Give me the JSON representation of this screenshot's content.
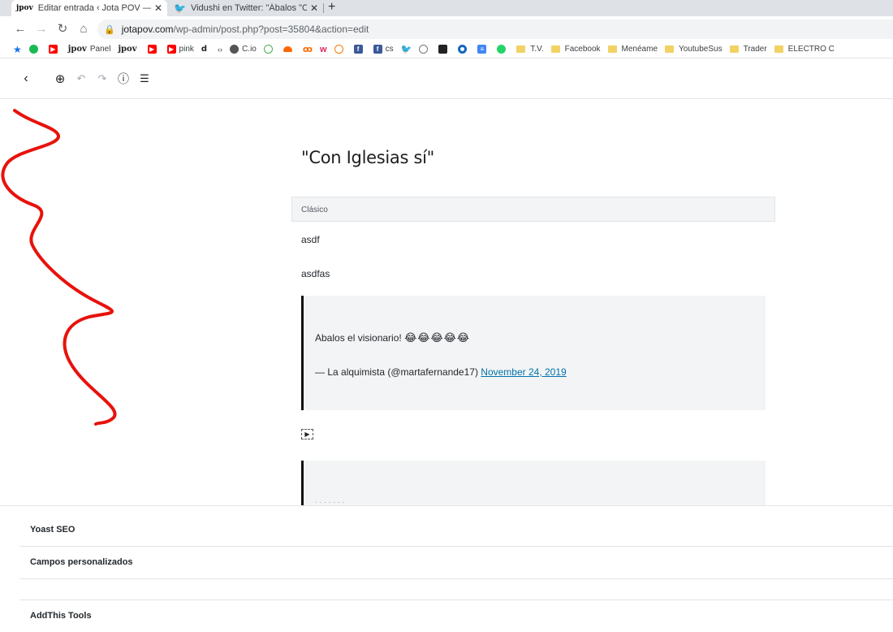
{
  "browser": {
    "tabs": [
      {
        "favicon": "jpov",
        "title": "Editar entrada ‹ Jota POV — Wor"
      },
      {
        "favicon": "twitter-icon",
        "title": "Vidushi en Twitter: \"Ábalos \"Con"
      }
    ],
    "tab_close": "✕",
    "new_tab": "+",
    "url_host": "jotapov.com",
    "url_path": "/wp-admin/post.php?post=35804&action=edit",
    "bookmarks": [
      {
        "icon": "star-icon"
      },
      {
        "icon": "spotify-icon"
      },
      {
        "icon": "youtube-icon"
      },
      {
        "icon": "jpov",
        "label": "Panel"
      },
      {
        "icon": "jpov"
      },
      {
        "icon": "youtube-icon"
      },
      {
        "icon": "youtube-icon",
        "label": "pink"
      },
      {
        "icon": "d"
      },
      {
        "icon": "code-icon"
      },
      {
        "icon": "cio-icon",
        "label": "C.io"
      },
      {
        "icon": "green-circle-icon"
      },
      {
        "icon": "cloud-icon"
      },
      {
        "icon": "link-icon"
      },
      {
        "icon": "w-icon"
      },
      {
        "icon": "hat-icon"
      },
      {
        "icon": "facebook-icon"
      },
      {
        "icon": "facebook-icon",
        "label": "cs"
      },
      {
        "icon": "twitter-icon"
      },
      {
        "icon": "phone-icon"
      },
      {
        "icon": "dark-square-icon"
      },
      {
        "icon": "circle-icon"
      },
      {
        "icon": "doc-icon"
      },
      {
        "icon": "whatsapp-icon"
      },
      {
        "folder": true,
        "label": "T.V."
      },
      {
        "folder": true,
        "label": "Facebook"
      },
      {
        "folder": true,
        "label": "Menéame"
      },
      {
        "folder": true,
        "label": "YoutubeSus"
      },
      {
        "folder": true,
        "label": "Trader"
      },
      {
        "folder": true,
        "label": "ELECTRO C"
      }
    ]
  },
  "editor": {
    "post_title": "\"Con Iglesias sí\"",
    "classic_label": "Clásico",
    "paragraphs": [
      "asdf",
      "asdfas"
    ],
    "quote": {
      "text": "Abalos el visionario!",
      "emoji": "😂😂😂😂😂",
      "cite_prefix": "— La alquimista (@martafernande17)",
      "cite_link": "November 24, 2019"
    },
    "video_glyph": "▶"
  },
  "metaboxes": [
    "Yoast SEO",
    "Campos personalizados",
    "AddThis Tools"
  ],
  "colors": {
    "annotation_red": "#e8120c",
    "link": "#0073aa"
  }
}
